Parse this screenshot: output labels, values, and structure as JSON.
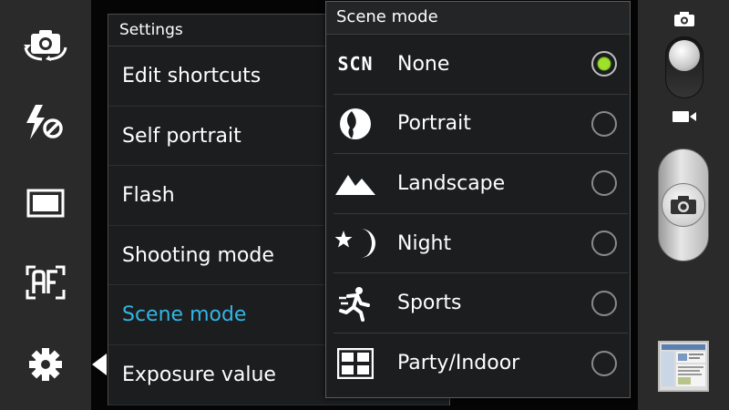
{
  "left_toolbar": {
    "items": [
      {
        "icon": "switch-camera-icon"
      },
      {
        "icon": "flash-off-icon"
      },
      {
        "icon": "photo-size-icon"
      },
      {
        "icon": "focus-mode-af-icon",
        "text": "AF"
      },
      {
        "icon": "settings-gear-icon"
      }
    ]
  },
  "settings": {
    "title": "Settings",
    "items": [
      {
        "label": "Edit shortcuts"
      },
      {
        "label": "Self portrait"
      },
      {
        "label": "Flash"
      },
      {
        "label": "Shooting mode"
      },
      {
        "label": "Scene mode",
        "active": true
      },
      {
        "label": "Exposure value"
      }
    ]
  },
  "scene_mode": {
    "title": "Scene mode",
    "selected": "None",
    "options": [
      {
        "label": "None",
        "icon": "scn-icon",
        "icon_text": "SCN",
        "selected": true
      },
      {
        "label": "Portrait",
        "icon": "portrait-icon",
        "selected": false
      },
      {
        "label": "Landscape",
        "icon": "landscape-icon",
        "selected": false
      },
      {
        "label": "Night",
        "icon": "night-icon",
        "selected": false
      },
      {
        "label": "Sports",
        "icon": "sports-icon",
        "selected": false
      },
      {
        "label": "Party/Indoor",
        "icon": "party-indoor-icon",
        "selected": false
      }
    ]
  },
  "right_bar": {
    "mode_switch": {
      "top_icon": "camera-mode-icon",
      "bottom_icon": "video-mode-icon",
      "current": "camera"
    },
    "shutter_icon": "camera-shutter-icon",
    "gallery_icon": "gallery-thumbnail"
  },
  "colors": {
    "accent": "#33b5e5",
    "radio_selected": "#8fd12a",
    "panel_bg": "#1c1d1f",
    "bar_bg": "#2a2a2a"
  }
}
